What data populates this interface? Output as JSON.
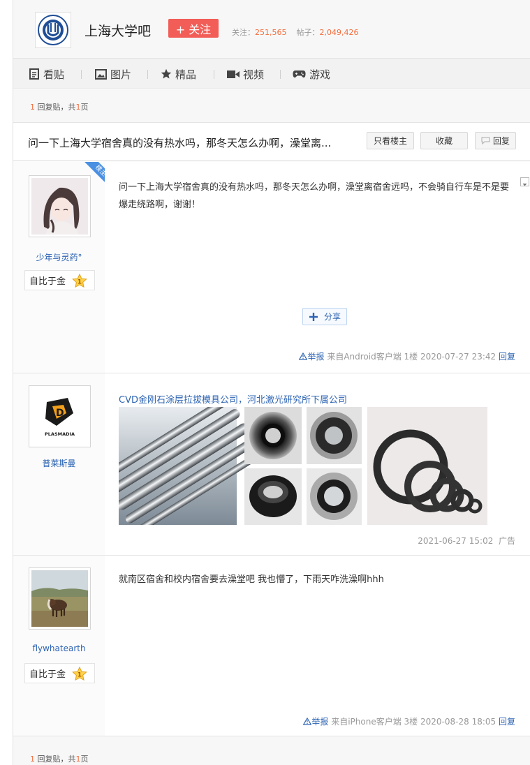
{
  "header": {
    "forum_name": "上海大学吧",
    "follow_label": "+ 关注",
    "follow_count_label": "关注：",
    "follow_count": "251,565",
    "post_count_label": "帖子：",
    "post_count": "2,049,426",
    "accent": "#f25d57"
  },
  "nav": {
    "tabs": [
      {
        "label": "看贴",
        "icon": "document-icon"
      },
      {
        "label": "图片",
        "icon": "image-icon"
      },
      {
        "label": "精品",
        "icon": "star-icon"
      },
      {
        "label": "视频",
        "icon": "video-camera-icon"
      },
      {
        "label": "游戏",
        "icon": "gamepad-icon"
      }
    ]
  },
  "pager_top": {
    "reply_count": "1",
    "reply_suffix": " 回复贴，共",
    "page_count": "1",
    "page_suffix": "页"
  },
  "pager_bottom": {
    "reply_count": "1",
    "reply_suffix": " 回复贴，共",
    "page_count": "1",
    "page_suffix": "页"
  },
  "thread": {
    "title": "问一下上海大学宿舍真的没有热水吗，那冬天怎么办啊，澡堂离...",
    "only_op_label": "只看楼主",
    "favorite_label": "收藏",
    "reply_label": "回复"
  },
  "posts": [
    {
      "author": "少年与灵药°",
      "op_badge": "楼主",
      "level_title": "自比于金",
      "level": "1",
      "text": "问一下上海大学宿舍真的没有热水吗，那冬天怎么办啊，澡堂离宿舍远吗，不会骑自行车是不是要爆走绕路啊，谢谢！",
      "share_label": "分享",
      "report_label": "举报",
      "client": "来自Android客户端",
      "floor": "1楼",
      "time": "2020-07-27 23:42",
      "reply_label": "回复"
    },
    {
      "author": "普莱斯曼",
      "avatar_text": "PLASMADIA",
      "ad_title": "CVD金刚石涂层拉拔模具公司，河北激光研究所下属公司",
      "time": "2021-06-27 15:02",
      "ad_label": "广告"
    },
    {
      "author": "flywhatearth",
      "level_title": "自比于金",
      "level": "1",
      "text": "就南区宿舍和校内宿舍要去澡堂吧 我也懵了，下雨天咋洗澡啊hhh",
      "report_label": "举报",
      "client": "来自iPhone客户端",
      "floor": "3楼",
      "time": "2020-08-28 18:05",
      "reply_label": "回复"
    }
  ]
}
